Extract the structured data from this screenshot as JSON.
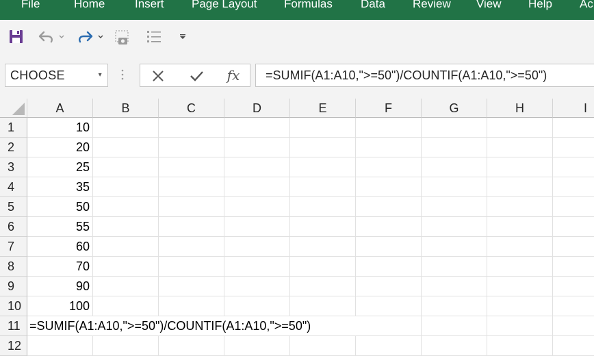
{
  "ribbon": {
    "tabs": [
      "File",
      "Home",
      "Insert",
      "Page Layout",
      "Formulas",
      "Data",
      "Review",
      "View",
      "Help",
      "Ac"
    ],
    "bg_color": "#217346"
  },
  "quick_access": {
    "icons": [
      "save-icon",
      "undo-icon",
      "redo-icon",
      "camera-icon",
      "list-icon",
      "customize-dropdown-icon"
    ]
  },
  "formula_bar": {
    "name_box": "CHOOSE",
    "cancel_icon": "✕",
    "enter_icon": "✓",
    "fx_label": "fx",
    "formula": "=SUMIF(A1:A10,\">=50\")/COUNTIF(A1:A10,\">=50\")"
  },
  "sheet": {
    "columns": [
      "A",
      "B",
      "C",
      "D",
      "E",
      "F",
      "G",
      "H",
      "I"
    ],
    "rows": [
      "1",
      "2",
      "3",
      "4",
      "5",
      "6",
      "7",
      "8",
      "9",
      "10",
      "11",
      "12"
    ],
    "column_a_values": [
      "10",
      "20",
      "25",
      "35",
      "50",
      "55",
      "60",
      "70",
      "90",
      "100"
    ],
    "a11_formula": "=SUMIF(A1:A10,\">=50\")/COUNTIF(A1:A10,\">=50\")"
  }
}
